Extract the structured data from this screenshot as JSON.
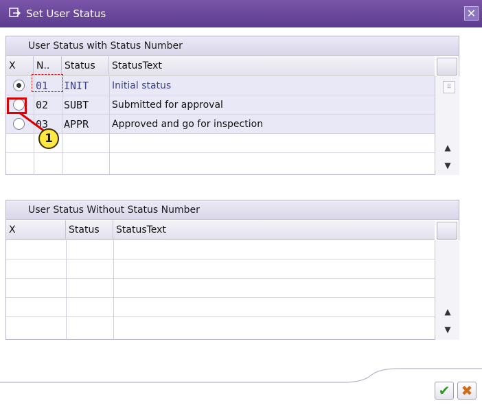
{
  "window": {
    "title": "Set User Status",
    "icon": "status-dialog-icon",
    "close_icon": "close-icon"
  },
  "panel1": {
    "title": "User Status with Status Number",
    "headers": {
      "select": "X",
      "number": "N..",
      "status": "Status",
      "text": "StatusText"
    },
    "rows": [
      {
        "selected": true,
        "number": "01",
        "status": "INIT",
        "text": "Initial status"
      },
      {
        "selected": false,
        "number": "02",
        "status": "SUBT",
        "text": "Submitted for approval"
      },
      {
        "selected": false,
        "number": "03",
        "status": "APPR",
        "text": "Approved and go for inspection"
      }
    ]
  },
  "panel2": {
    "title": "User Status Without Status Number",
    "headers": {
      "select": "X",
      "status": "Status",
      "text": "StatusText"
    }
  },
  "callout": {
    "label": "1",
    "color": "#d80000",
    "badge_color": "#ffe840"
  },
  "buttons": {
    "ok_icon": "checkmark-icon",
    "cancel_icon": "cancel-icon",
    "ok_symbol": "✔",
    "cancel_symbol": "✖"
  },
  "colors": {
    "titlebar": "#5c3b8e",
    "text_blue": "#3b3f9a"
  }
}
